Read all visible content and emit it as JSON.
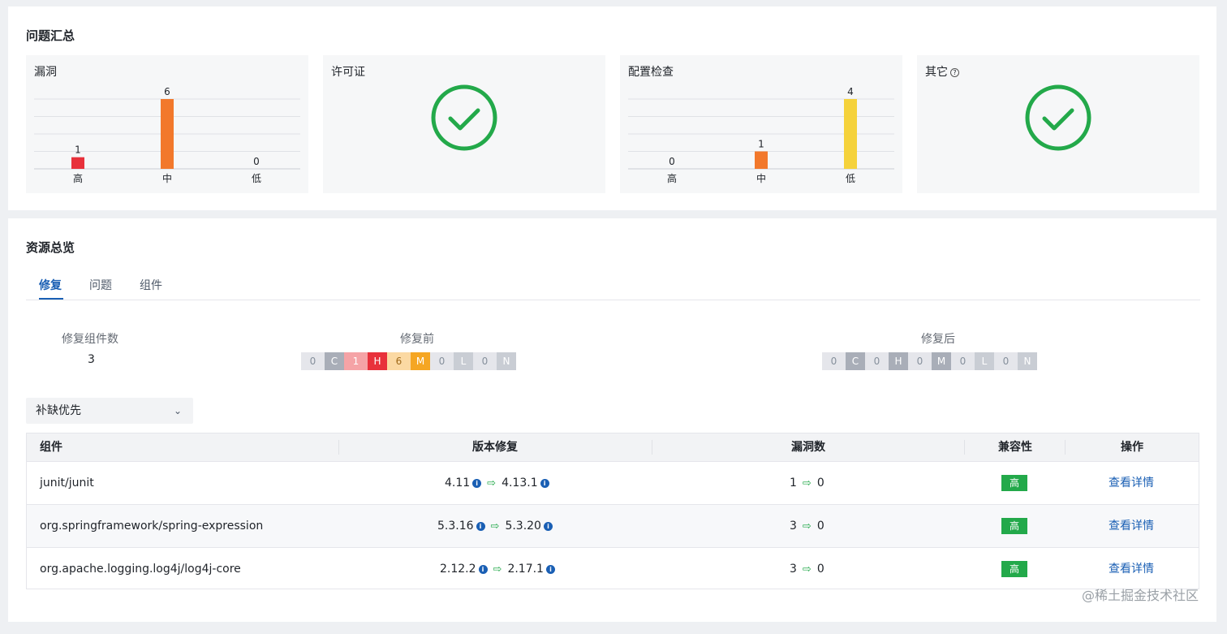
{
  "summary": {
    "title": "问题汇总",
    "cards": [
      {
        "title": "漏洞"
      },
      {
        "title": "许可证"
      },
      {
        "title": "配置检查"
      },
      {
        "title": "其它",
        "help": "?"
      }
    ]
  },
  "chart_data": [
    {
      "type": "bar",
      "title": "漏洞",
      "categories": [
        "高",
        "中",
        "低"
      ],
      "values": [
        1,
        6,
        0
      ],
      "colors": [
        "#e8313b",
        "#f2782b",
        "#f5c63b"
      ],
      "ylim": [
        0,
        6
      ]
    },
    {
      "type": "bar",
      "title": "配置检查",
      "categories": [
        "高",
        "中",
        "低"
      ],
      "values": [
        0,
        1,
        4
      ],
      "colors": [
        "#e8313b",
        "#f2782b",
        "#f5d23b"
      ],
      "ylim": [
        0,
        4
      ]
    }
  ],
  "overview": {
    "title": "资源总览",
    "tabs": [
      {
        "label": "修复"
      },
      {
        "label": "问题"
      },
      {
        "label": "组件"
      }
    ],
    "fixed_count_label": "修复组件数",
    "fixed_count": "3",
    "before_label": "修复前",
    "after_label": "修复后",
    "before": [
      {
        "count": "0",
        "letter": "C"
      },
      {
        "count": "1",
        "letter": "H"
      },
      {
        "count": "6",
        "letter": "M"
      },
      {
        "count": "0",
        "letter": "L"
      },
      {
        "count": "0",
        "letter": "N"
      }
    ],
    "after": [
      {
        "count": "0",
        "letter": "C"
      },
      {
        "count": "0",
        "letter": "H"
      },
      {
        "count": "0",
        "letter": "M"
      },
      {
        "count": "0",
        "letter": "L"
      },
      {
        "count": "0",
        "letter": "N"
      }
    ],
    "select_value": "补缺优先",
    "table": {
      "headers": [
        "组件",
        "版本修复",
        "漏洞数",
        "兼容性",
        "操作"
      ],
      "rows": [
        {
          "component": "junit/junit",
          "from": "4.11",
          "to": "4.13.1",
          "vuln_from": "1",
          "vuln_to": "0",
          "compat": "高",
          "action": "查看详情"
        },
        {
          "component": "org.springframework/spring-expression",
          "from": "5.3.16",
          "to": "5.3.20",
          "vuln_from": "3",
          "vuln_to": "0",
          "compat": "高",
          "action": "查看详情"
        },
        {
          "component": "org.apache.logging.log4j/log4j-core",
          "from": "2.12.2",
          "to": "2.17.1",
          "vuln_from": "3",
          "vuln_to": "0",
          "compat": "高",
          "action": "查看详情"
        }
      ]
    }
  },
  "watermark": "@稀土掘金技术社区",
  "colors": {
    "accent": "#1a5fb4",
    "success": "#23a94a",
    "critical": "#e8313b",
    "medium": "#f5a623",
    "neutral": "#c9cdd4"
  }
}
